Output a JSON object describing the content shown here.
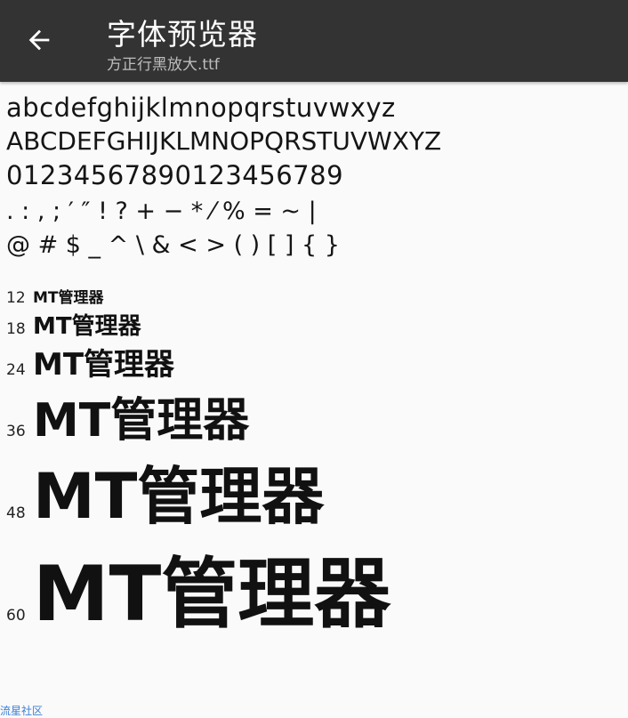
{
  "toolbar": {
    "title": "字体预览器",
    "subtitle": "方正行黑放大.ttf",
    "back_icon": "arrow-left-icon"
  },
  "preview": {
    "lines": [
      "abcdefghijklmnopqrstuvwxyz",
      "ABCDEFGHIJKLMNOPQRSTUVWXYZ",
      "01234567890123456789",
      ". : , ; ′ ″ ! ? + − * ⁄ % = ~ |",
      "@ # $ _ ^ \\ & < > ( ) [ ] { }"
    ],
    "sizes": [
      {
        "size": "12",
        "text": "MT管理器"
      },
      {
        "size": "18",
        "text": "MT管理器"
      },
      {
        "size": "24",
        "text": "MT管理器"
      },
      {
        "size": "36",
        "text": "MT管理器"
      },
      {
        "size": "48",
        "text": "MT管理器"
      },
      {
        "size": "60",
        "text": "MT管理器"
      }
    ]
  },
  "watermark": "流星社区",
  "colors": {
    "toolbar_bg": "#333333",
    "background": "#fafafa",
    "title": "#ffffff",
    "subtitle": "#bdbdbd",
    "watermark": "#3b7fd6"
  }
}
